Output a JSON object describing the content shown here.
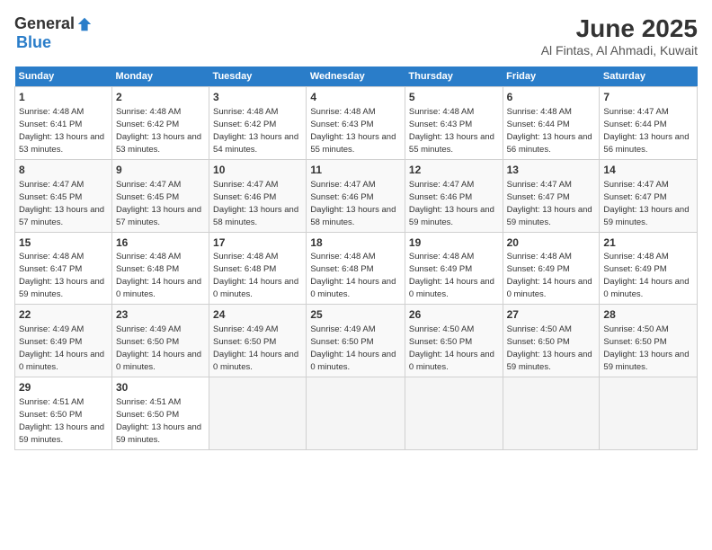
{
  "header": {
    "logo_general": "General",
    "logo_blue": "Blue",
    "month_title": "June 2025",
    "location": "Al Fintas, Al Ahmadi, Kuwait"
  },
  "calendar": {
    "days_of_week": [
      "Sunday",
      "Monday",
      "Tuesday",
      "Wednesday",
      "Thursday",
      "Friday",
      "Saturday"
    ],
    "weeks": [
      [
        null,
        {
          "day": 2,
          "sunrise": "4:48 AM",
          "sunset": "6:42 PM",
          "daylight": "13 hours and 53 minutes."
        },
        {
          "day": 3,
          "sunrise": "4:48 AM",
          "sunset": "6:42 PM",
          "daylight": "13 hours and 54 minutes."
        },
        {
          "day": 4,
          "sunrise": "4:48 AM",
          "sunset": "6:43 PM",
          "daylight": "13 hours and 55 minutes."
        },
        {
          "day": 5,
          "sunrise": "4:48 AM",
          "sunset": "6:43 PM",
          "daylight": "13 hours and 55 minutes."
        },
        {
          "day": 6,
          "sunrise": "4:48 AM",
          "sunset": "6:44 PM",
          "daylight": "13 hours and 56 minutes."
        },
        {
          "day": 7,
          "sunrise": "4:47 AM",
          "sunset": "6:44 PM",
          "daylight": "13 hours and 56 minutes."
        }
      ],
      [
        {
          "day": 1,
          "sunrise": "4:48 AM",
          "sunset": "6:41 PM",
          "daylight": "13 hours and 53 minutes."
        },
        null,
        null,
        null,
        null,
        null,
        null
      ],
      [
        {
          "day": 8,
          "sunrise": "4:47 AM",
          "sunset": "6:45 PM",
          "daylight": "13 hours and 57 minutes."
        },
        {
          "day": 9,
          "sunrise": "4:47 AM",
          "sunset": "6:45 PM",
          "daylight": "13 hours and 57 minutes."
        },
        {
          "day": 10,
          "sunrise": "4:47 AM",
          "sunset": "6:46 PM",
          "daylight": "13 hours and 58 minutes."
        },
        {
          "day": 11,
          "sunrise": "4:47 AM",
          "sunset": "6:46 PM",
          "daylight": "13 hours and 58 minutes."
        },
        {
          "day": 12,
          "sunrise": "4:47 AM",
          "sunset": "6:46 PM",
          "daylight": "13 hours and 59 minutes."
        },
        {
          "day": 13,
          "sunrise": "4:47 AM",
          "sunset": "6:47 PM",
          "daylight": "13 hours and 59 minutes."
        },
        {
          "day": 14,
          "sunrise": "4:47 AM",
          "sunset": "6:47 PM",
          "daylight": "13 hours and 59 minutes."
        }
      ],
      [
        {
          "day": 15,
          "sunrise": "4:48 AM",
          "sunset": "6:47 PM",
          "daylight": "13 hours and 59 minutes."
        },
        {
          "day": 16,
          "sunrise": "4:48 AM",
          "sunset": "6:48 PM",
          "daylight": "14 hours and 0 minutes."
        },
        {
          "day": 17,
          "sunrise": "4:48 AM",
          "sunset": "6:48 PM",
          "daylight": "14 hours and 0 minutes."
        },
        {
          "day": 18,
          "sunrise": "4:48 AM",
          "sunset": "6:48 PM",
          "daylight": "14 hours and 0 minutes."
        },
        {
          "day": 19,
          "sunrise": "4:48 AM",
          "sunset": "6:49 PM",
          "daylight": "14 hours and 0 minutes."
        },
        {
          "day": 20,
          "sunrise": "4:48 AM",
          "sunset": "6:49 PM",
          "daylight": "14 hours and 0 minutes."
        },
        {
          "day": 21,
          "sunrise": "4:48 AM",
          "sunset": "6:49 PM",
          "daylight": "14 hours and 0 minutes."
        }
      ],
      [
        {
          "day": 22,
          "sunrise": "4:49 AM",
          "sunset": "6:49 PM",
          "daylight": "14 hours and 0 minutes."
        },
        {
          "day": 23,
          "sunrise": "4:49 AM",
          "sunset": "6:50 PM",
          "daylight": "14 hours and 0 minutes."
        },
        {
          "day": 24,
          "sunrise": "4:49 AM",
          "sunset": "6:50 PM",
          "daylight": "14 hours and 0 minutes."
        },
        {
          "day": 25,
          "sunrise": "4:49 AM",
          "sunset": "6:50 PM",
          "daylight": "14 hours and 0 minutes."
        },
        {
          "day": 26,
          "sunrise": "4:50 AM",
          "sunset": "6:50 PM",
          "daylight": "14 hours and 0 minutes."
        },
        {
          "day": 27,
          "sunrise": "4:50 AM",
          "sunset": "6:50 PM",
          "daylight": "13 hours and 59 minutes."
        },
        {
          "day": 28,
          "sunrise": "4:50 AM",
          "sunset": "6:50 PM",
          "daylight": "13 hours and 59 minutes."
        }
      ],
      [
        {
          "day": 29,
          "sunrise": "4:51 AM",
          "sunset": "6:50 PM",
          "daylight": "13 hours and 59 minutes."
        },
        {
          "day": 30,
          "sunrise": "4:51 AM",
          "sunset": "6:50 PM",
          "daylight": "13 hours and 59 minutes."
        },
        null,
        null,
        null,
        null,
        null
      ]
    ]
  }
}
